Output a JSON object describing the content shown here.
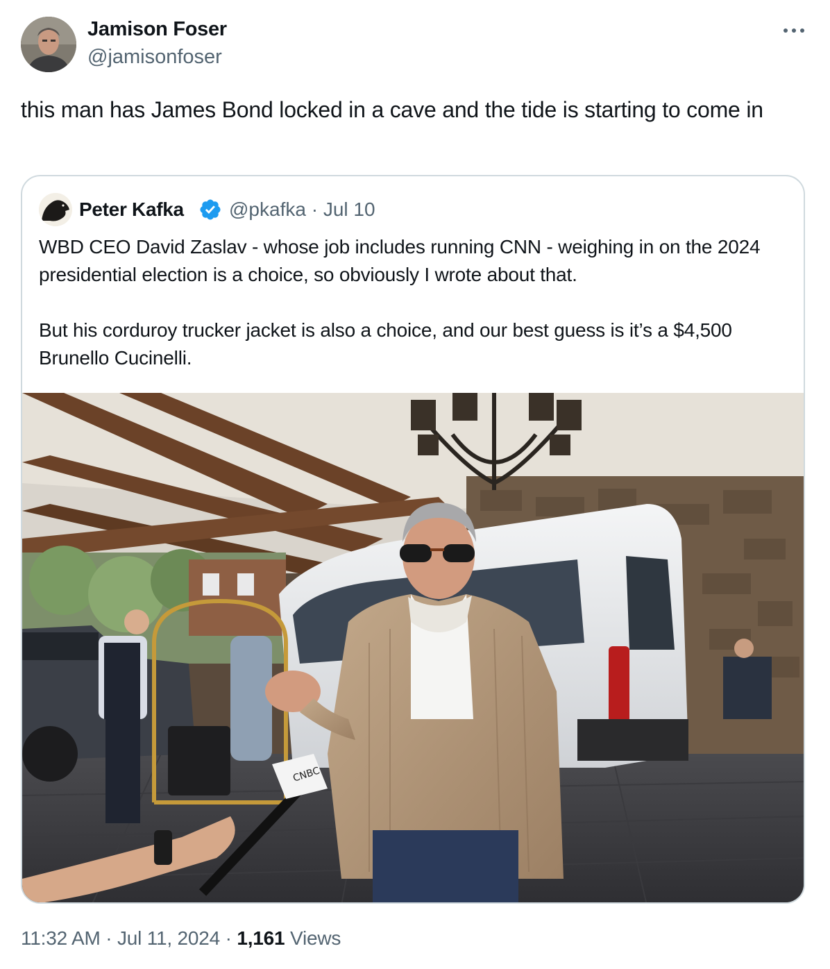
{
  "tweet": {
    "author_name": "Jamison Foser",
    "author_handle": "@jamisonfoser",
    "text": "this man has James Bond locked in a cave and the tide is starting to come in",
    "more_icon": "more-horizontal-icon"
  },
  "quoted_tweet": {
    "author_name": "Peter Kafka",
    "verified_icon": "verified-badge-icon",
    "verified_color": "#1d9bf0",
    "author_handle": "@pkafka",
    "separator": "·",
    "date": "Jul 10",
    "paragraphs": [
      "WBD CEO David Zaslav - whose job includes running CNN - weighing in on the 2024 presidential election is a choice, so obviously I wrote about that.",
      "But his corduroy trucker jacket is also a choice, and our best guess is it’s a $4,500 Brunello Cucinelli."
    ],
    "photo_mic_flag": "CNBC"
  },
  "meta": {
    "time": "11:32 AM",
    "sep1": "·",
    "date": "Jul 11, 2024",
    "sep2": "·",
    "views_count": "1,161",
    "views_label": "Views"
  },
  "colors": {
    "text_primary": "#0f1419",
    "text_secondary": "#536471",
    "border": "#cfd9de"
  }
}
